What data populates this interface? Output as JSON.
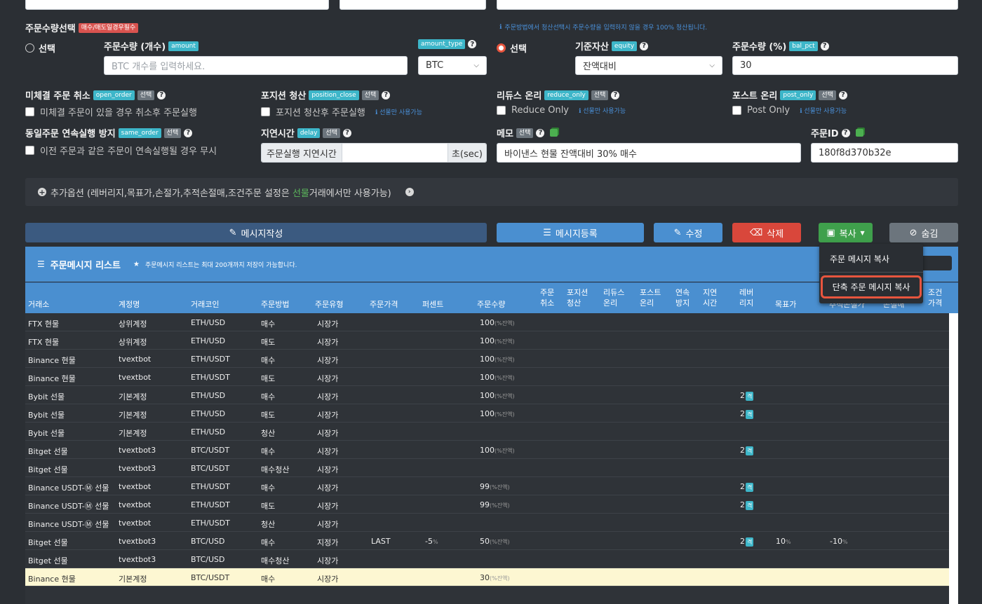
{
  "top_inputs": [
    "",
    "",
    ""
  ],
  "order_qty_section": {
    "title": "주문수량선택",
    "required_badge": "매수/매도일경우필수",
    "notice": "주문방법에서 청산선택시 주문수량을 입력하지 않을 경우 100% 청산됩니다."
  },
  "amount": {
    "radio_label": "선택",
    "label": "주문수량 (개수)",
    "tag": "amount",
    "placeholder": "BTC 개수를 입력하세요.",
    "type_tag": "amount_type",
    "type_value": "BTC"
  },
  "equity": {
    "radio_label": "선택",
    "label": "기준자산",
    "tag": "equity",
    "value": "잔액대비",
    "pct_label": "주문수량 (%)",
    "pct_tag": "bal_pct",
    "pct_value": "30"
  },
  "options": {
    "select_tag": "선택",
    "open_order": {
      "label": "미체결 주문 취소",
      "tag": "open_order",
      "check": "미체결 주문이 있을 경우 취소후 주문실행"
    },
    "position_close": {
      "label": "포지션 청산",
      "tag": "position_close",
      "check": "포지션 청산후 주문실행",
      "hint": "선물만 사용가능"
    },
    "reduce_only": {
      "label": "리듀스 온리",
      "tag": "reduce_only",
      "check": "Reduce Only",
      "hint": "선물만 사용가능"
    },
    "post_only": {
      "label": "포스트 온리",
      "tag": "post_only",
      "check": "Post Only",
      "hint": "선물만 사용가능"
    },
    "same_order": {
      "label": "동일주문 연속실행 방지",
      "tag": "same_order",
      "check": "이전 주문과 같은 주문이 연속실행될 경우 무시"
    },
    "delay": {
      "label": "지연시간",
      "tag": "delay",
      "prefix": "주문실행 지연시간",
      "suffix": "초(sec)",
      "value": ""
    },
    "memo": {
      "label": "메모",
      "value": "바이낸스 현물 잔액대비 30% 매수"
    },
    "order_id": {
      "label": "주문ID",
      "value": "180f8d370b32e"
    }
  },
  "extra": {
    "before": "추가옵션 (레버리지,목표가,손절가,추적손절매,조건주문 설정은 ",
    "highlight": "선물",
    "after": "거래에서만 사용가능)"
  },
  "buttons": {
    "write": "메시지작성",
    "register": "메시지등록",
    "edit": "수정",
    "delete": "삭제",
    "copy": "복사",
    "hide": "숨김"
  },
  "dropdown": {
    "item1": "주문 메시지 복사",
    "item2": "단축 주문 메시지 복사"
  },
  "list": {
    "title": "주문메시지 리스트",
    "note": "주문메시지 리스트는 최대 200개까지 저장이 가능합니다.",
    "headers": {
      "exchange": "거래소",
      "account": "계정명",
      "coin": "거래코인",
      "method": "주문방법",
      "type": "주문유형",
      "price": "주문가격",
      "percent": "퍼센트",
      "qty": "주문수량",
      "cancel": [
        "주문",
        "취소"
      ],
      "close": [
        "포지션",
        "청산"
      ],
      "reduce": [
        "리듀스",
        "온리"
      ],
      "post": [
        "포스트",
        "온리"
      ],
      "cont": [
        "연속",
        "방지"
      ],
      "delay": [
        "지연",
        "시간"
      ],
      "lev": [
        "레버",
        "리지"
      ],
      "target": "목표가",
      "trail": "추적손절가",
      "stop": "손절매",
      "cond": [
        "조건",
        "가격"
      ]
    },
    "rows": [
      {
        "ex": "FTX 현물",
        "acct": "상위계정",
        "coin": "ETH/USD",
        "method": "매수",
        "type": "시장가",
        "price": "",
        "pct": "",
        "qty": "100",
        "qty_unit": "(%잔액)",
        "lev": "",
        "target": "",
        "stop": ""
      },
      {
        "ex": "FTX 현물",
        "acct": "상위계정",
        "coin": "ETH/USD",
        "method": "매도",
        "type": "시장가",
        "price": "",
        "pct": "",
        "qty": "100",
        "qty_unit": "(%잔액)",
        "lev": "",
        "target": "",
        "stop": ""
      },
      {
        "ex": "Binance 현물",
        "acct": "tvextbot",
        "coin": "ETH/USDT",
        "method": "매수",
        "type": "시장가",
        "price": "",
        "pct": "",
        "qty": "100",
        "qty_unit": "(%잔액)",
        "lev": "",
        "target": "",
        "stop": ""
      },
      {
        "ex": "Binance 현물",
        "acct": "tvextbot",
        "coin": "ETH/USDT",
        "method": "매도",
        "type": "시장가",
        "price": "",
        "pct": "",
        "qty": "100",
        "qty_unit": "(%잔액)",
        "lev": "",
        "target": "",
        "stop": ""
      },
      {
        "ex": "Bybit 선물",
        "acct": "기본계정",
        "coin": "ETH/USD",
        "method": "매수",
        "type": "시장가",
        "price": "",
        "pct": "",
        "qty": "100",
        "qty_unit": "(%잔액)",
        "lev": "2",
        "target": "",
        "stop": ""
      },
      {
        "ex": "Bybit 선물",
        "acct": "기본계정",
        "coin": "ETH/USD",
        "method": "매도",
        "type": "시장가",
        "price": "",
        "pct": "",
        "qty": "100",
        "qty_unit": "(%잔액)",
        "lev": "2",
        "target": "",
        "stop": ""
      },
      {
        "ex": "Bybit 선물",
        "acct": "기본계정",
        "coin": "ETH/USD",
        "method": "청산",
        "type": "시장가",
        "price": "",
        "pct": "",
        "qty": "",
        "qty_unit": "",
        "lev": "",
        "target": "",
        "stop": ""
      },
      {
        "ex": "Bitget 선물",
        "acct": "tvextbot3",
        "coin": "BTC/USDT",
        "method": "매수",
        "type": "시장가",
        "price": "",
        "pct": "",
        "qty": "100",
        "qty_unit": "(%잔액)",
        "lev": "2",
        "target": "",
        "stop": ""
      },
      {
        "ex": "Bitget 선물",
        "acct": "tvextbot3",
        "coin": "BTC/USDT",
        "method": "매수청산",
        "type": "시장가",
        "price": "",
        "pct": "",
        "qty": "",
        "qty_unit": "",
        "lev": "",
        "target": "",
        "stop": ""
      },
      {
        "ex": "Binance USDT-Ⓜ 선물",
        "acct": "tvextbot",
        "coin": "ETH/USDT",
        "method": "매수",
        "type": "시장가",
        "price": "",
        "pct": "",
        "qty": "99",
        "qty_unit": "(%잔액)",
        "lev": "2",
        "target": "",
        "stop": ""
      },
      {
        "ex": "Binance USDT-Ⓜ 선물",
        "acct": "tvextbot",
        "coin": "ETH/USDT",
        "method": "매도",
        "type": "시장가",
        "price": "",
        "pct": "",
        "qty": "99",
        "qty_unit": "(%잔액)",
        "lev": "2",
        "target": "",
        "stop": ""
      },
      {
        "ex": "Binance USDT-Ⓜ 선물",
        "acct": "tvextbot",
        "coin": "ETH/USDT",
        "method": "청산",
        "type": "시장가",
        "price": "",
        "pct": "",
        "qty": "",
        "qty_unit": "",
        "lev": "",
        "target": "",
        "stop": ""
      },
      {
        "ex": "Bitget 선물",
        "acct": "tvextbot3",
        "coin": "BTC/USD",
        "method": "매수",
        "type": "지정가",
        "price": "LAST",
        "pct": "-5",
        "qty": "50",
        "qty_unit": "(%잔액)",
        "lev": "2",
        "target": "10",
        "stop": "-10"
      },
      {
        "ex": "Bitget 선물",
        "acct": "tvextbot3",
        "coin": "BTC/USD",
        "method": "매수청산",
        "type": "시장가",
        "price": "",
        "pct": "",
        "qty": "",
        "qty_unit": "",
        "lev": "",
        "target": "",
        "stop": ""
      },
      {
        "ex": "Binance 현물",
        "acct": "기본계정",
        "coin": "BTC/USDT",
        "method": "매수",
        "type": "시장가",
        "price": "",
        "pct": "",
        "qty": "30",
        "qty_unit": "(%잔액)",
        "lev": "",
        "target": "",
        "stop": ""
      }
    ],
    "lev_unit": "격",
    "pct_unit": "%"
  }
}
